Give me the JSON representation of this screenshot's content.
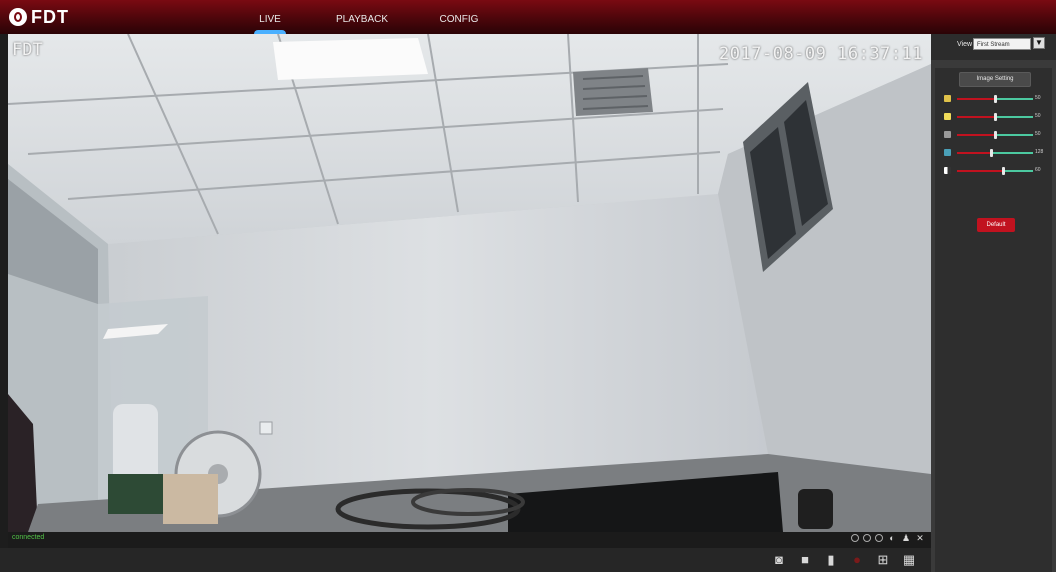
{
  "brand": {
    "logo_text": "FDT"
  },
  "nav": {
    "tabs": [
      {
        "label": "LIVE"
      },
      {
        "label": "PLAYBACK"
      },
      {
        "label": "CONFIG"
      }
    ],
    "active": "LIVE"
  },
  "video": {
    "osd_name": "FDT",
    "osd_timestamp": "2017-08-09 16:37:11"
  },
  "status": {
    "connection_text": "connected",
    "colors": {
      "connected": "#52c247"
    }
  },
  "panel": {
    "view_label": "View",
    "stream_selected": "First Stream",
    "image_setting_title": "Image Setting",
    "sliders": [
      {
        "icon": "brightness-icon",
        "value": "50",
        "level": 0.5
      },
      {
        "icon": "contrast-icon",
        "value": "50",
        "level": 0.5
      },
      {
        "icon": "saturation-icon",
        "value": "50",
        "level": 0.5
      },
      {
        "icon": "hue-icon",
        "value": "128",
        "level": 0.45
      },
      {
        "icon": "sharpness-icon",
        "value": "60",
        "level": 0.6
      }
    ],
    "default_button": "Default",
    "accent": "#c1121f"
  },
  "toolbar": {
    "icons": [
      "snapshot-icon",
      "record-icon",
      "fullscreen-icon",
      "stop-icon",
      "layout-4-icon",
      "layout-9-icon"
    ]
  }
}
